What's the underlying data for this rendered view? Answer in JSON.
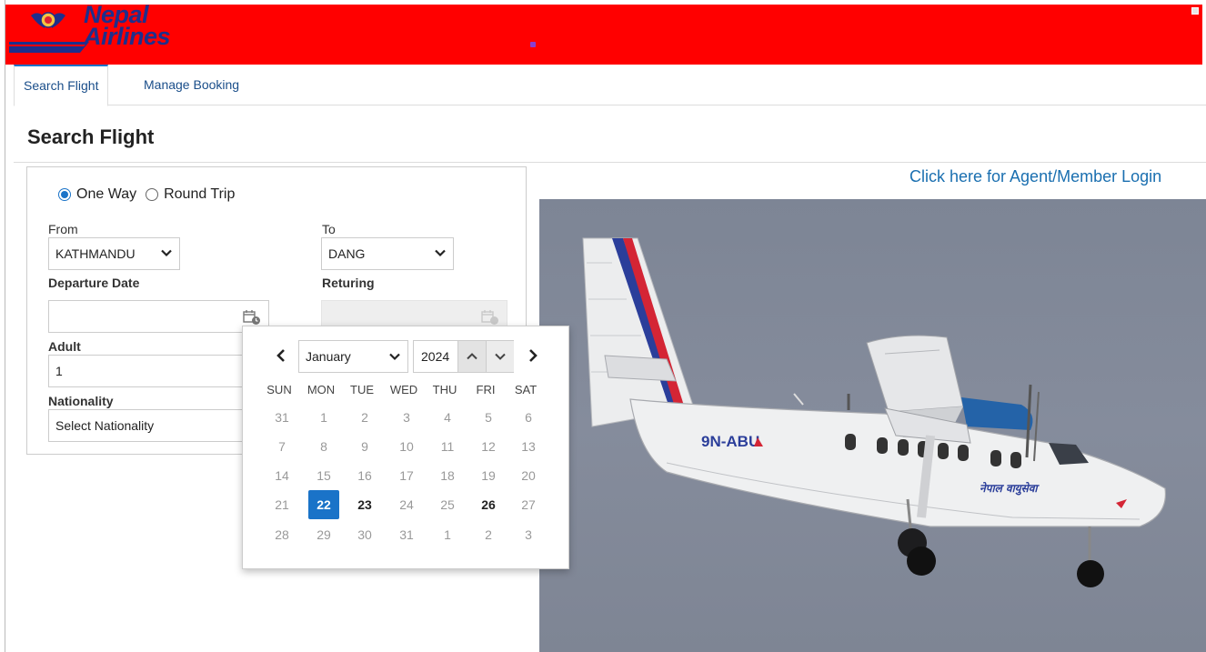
{
  "brand": {
    "line1": "Nepal",
    "line2": "Airlines"
  },
  "tabs": [
    {
      "label": "Search Flight"
    },
    {
      "label": "Manage Booking"
    }
  ],
  "page_title": "Search Flight",
  "trip_type": {
    "options": [
      "One Way",
      "Round Trip"
    ],
    "selected": "One Way"
  },
  "form": {
    "from_label": "From",
    "from_value": "KATHMANDU",
    "to_label": "To",
    "to_value": "DANG",
    "departure_label": "Departure Date",
    "departure_value": "",
    "returning_label": "Returing",
    "returning_value": "",
    "adult_label": "Adult",
    "adult_value": "1",
    "nationality_label": "Nationality",
    "nationality_value": "Select Nationality"
  },
  "agent_link": "Click here for Agent/Member Login",
  "datepicker": {
    "month": "January",
    "year": "2024",
    "weekdays": [
      "SUN",
      "MON",
      "TUE",
      "WED",
      "THU",
      "FRI",
      "SAT"
    ],
    "weeks": [
      [
        "31",
        "1",
        "2",
        "3",
        "4",
        "5",
        "6"
      ],
      [
        "7",
        "8",
        "9",
        "10",
        "11",
        "12",
        "13"
      ],
      [
        "14",
        "15",
        "16",
        "17",
        "18",
        "19",
        "20"
      ],
      [
        "21",
        "22",
        "23",
        "24",
        "25",
        "26",
        "27"
      ],
      [
        "28",
        "29",
        "30",
        "31",
        "1",
        "2",
        "3"
      ]
    ],
    "selected_day": "22",
    "available_days": [
      "23",
      "26"
    ]
  },
  "photo": {
    "registration": "9N-ABU",
    "script_text": "नेपाल वायुसेवा"
  },
  "colors": {
    "header": "#ff0000",
    "brand_blue": "#1e2f8c",
    "accent": "#1a73c8",
    "link": "#1a6fb0"
  }
}
